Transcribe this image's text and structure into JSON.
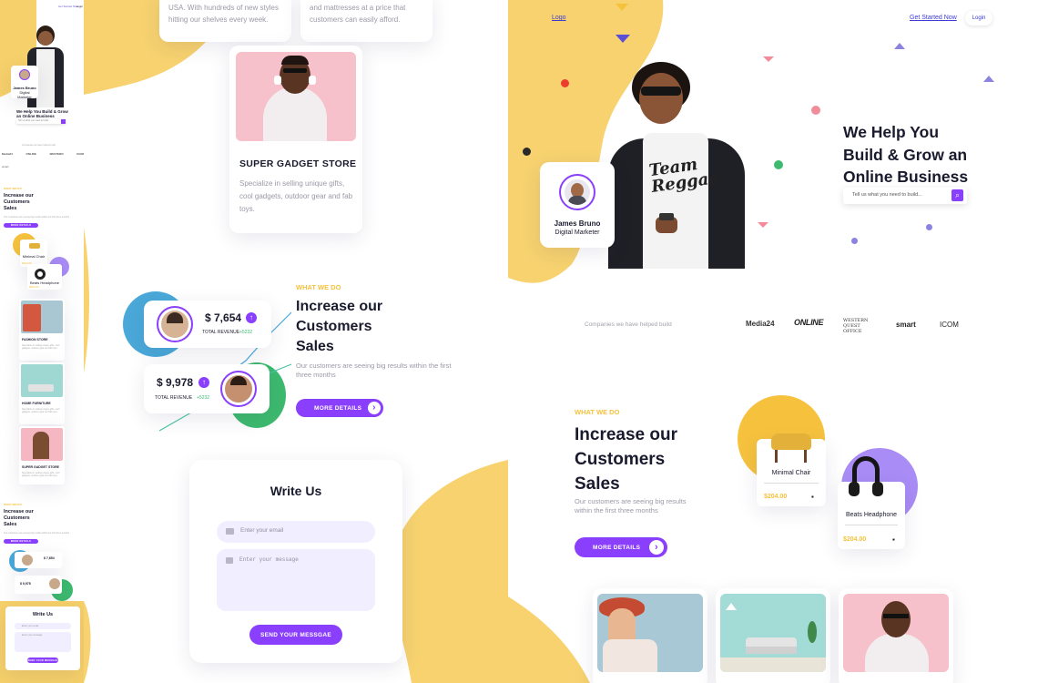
{
  "mini": {
    "nav_links": [
      "Get Started Now",
      "Login"
    ],
    "profile_name": "James Bruno",
    "profile_role": "Digital Marketer",
    "hero_title": "We Help You Build & Grow an Online Business",
    "search_placeholder": "Tell us what you need to build...",
    "companies_label": "Companies we have helped build",
    "logos": [
      "Media24",
      "ONLINE",
      "WESTERN",
      "smart",
      "ICOM"
    ],
    "section_tag": "WHAT WE DO",
    "section_title": "Increase our Customers Sales",
    "section_sub": "Our customers are seeing big results within the first three months",
    "more_details": "MORE DETAILS",
    "products": [
      {
        "name": "Minimal Chair",
        "price": "$204.00"
      },
      {
        "name": "Beats Headphone",
        "price": "$204.00"
      }
    ],
    "stores": [
      {
        "title": "FASHION STORE",
        "desc": "Specialize in selling unique gifts, cool gadgets, outdoor gear and fab toys."
      },
      {
        "title": "HOME FURNITURE",
        "desc": "Specialize in selling unique gifts, cool gadgets, outdoor gear and fab toys."
      },
      {
        "title": "SUPER GADGET STORE",
        "desc": "Specialize in selling unique gifts, cool gadgets, outdoor gear and fab toys."
      }
    ],
    "stat1_value": "$ 7,654",
    "stat2_value": "$ 9,978",
    "write_title": "Write Us",
    "email_placeholder": "Enter your email",
    "message_placeholder": "Enter your message",
    "send_label": "SEND YOUR MESSGAE"
  },
  "middle": {
    "card1_text": "USA. With hundreds of new styles hitting our shelves every week.",
    "card2_text": "and mattresses at a price that customers can easily afford.",
    "gadget_title": "SUPER GADGET STORE",
    "gadget_desc": "Specialize in selling unique gifts, cool gadgets, outdoor gear and fab toys.",
    "tag": "WHAT WE DO",
    "title_lines": [
      "Increase our",
      "Customers",
      "Sales"
    ],
    "subtitle": "Our customers are seeing big results within the first three months",
    "more_details": "MORE DETAILS",
    "stat1": {
      "value": "$ 7,654",
      "label": "TOTAL REVENUE",
      "delta": "+5232"
    },
    "stat2": {
      "value": "$ 9,978",
      "label": "TOTAL REVENUE",
      "delta": "+5232"
    },
    "write_title": "Write Us",
    "email_placeholder": "Enter your email",
    "message_placeholder": "Enter your message",
    "send_label": "SEND YOUR MESSGAE"
  },
  "right": {
    "logo": "Logo",
    "cta": "Get Started Now",
    "login": "Login",
    "profile_name": "James Bruno",
    "profile_role": "Digital Marketer",
    "hero_lines": [
      "We Help You",
      "Build & Grow an",
      "Online Business"
    ],
    "search_placeholder": "Tell us what you need to build...",
    "companies_label": "Companies we have helped build",
    "logos": [
      "Media24",
      "ONLINE",
      "WESTERN QUEST OFFICE",
      "smart",
      "ICOM"
    ],
    "tag": "WHAT WE DO",
    "title_lines": [
      "Increase our",
      "Customers",
      "Sales"
    ],
    "subtitle": "Our customers are seeing big results within the first three months",
    "more_details": "MORE DETAILS",
    "product1": {
      "name": "Minimal Chair",
      "price": "$204.00"
    },
    "product2": {
      "name": "Beats Headphone",
      "price": "$204.00"
    }
  },
  "colors": {
    "accent": "#8a3ffc",
    "yellow": "#f6c23e",
    "green": "#3dba6f",
    "blue": "#4aa9d9",
    "pink": "#f28c9a"
  }
}
